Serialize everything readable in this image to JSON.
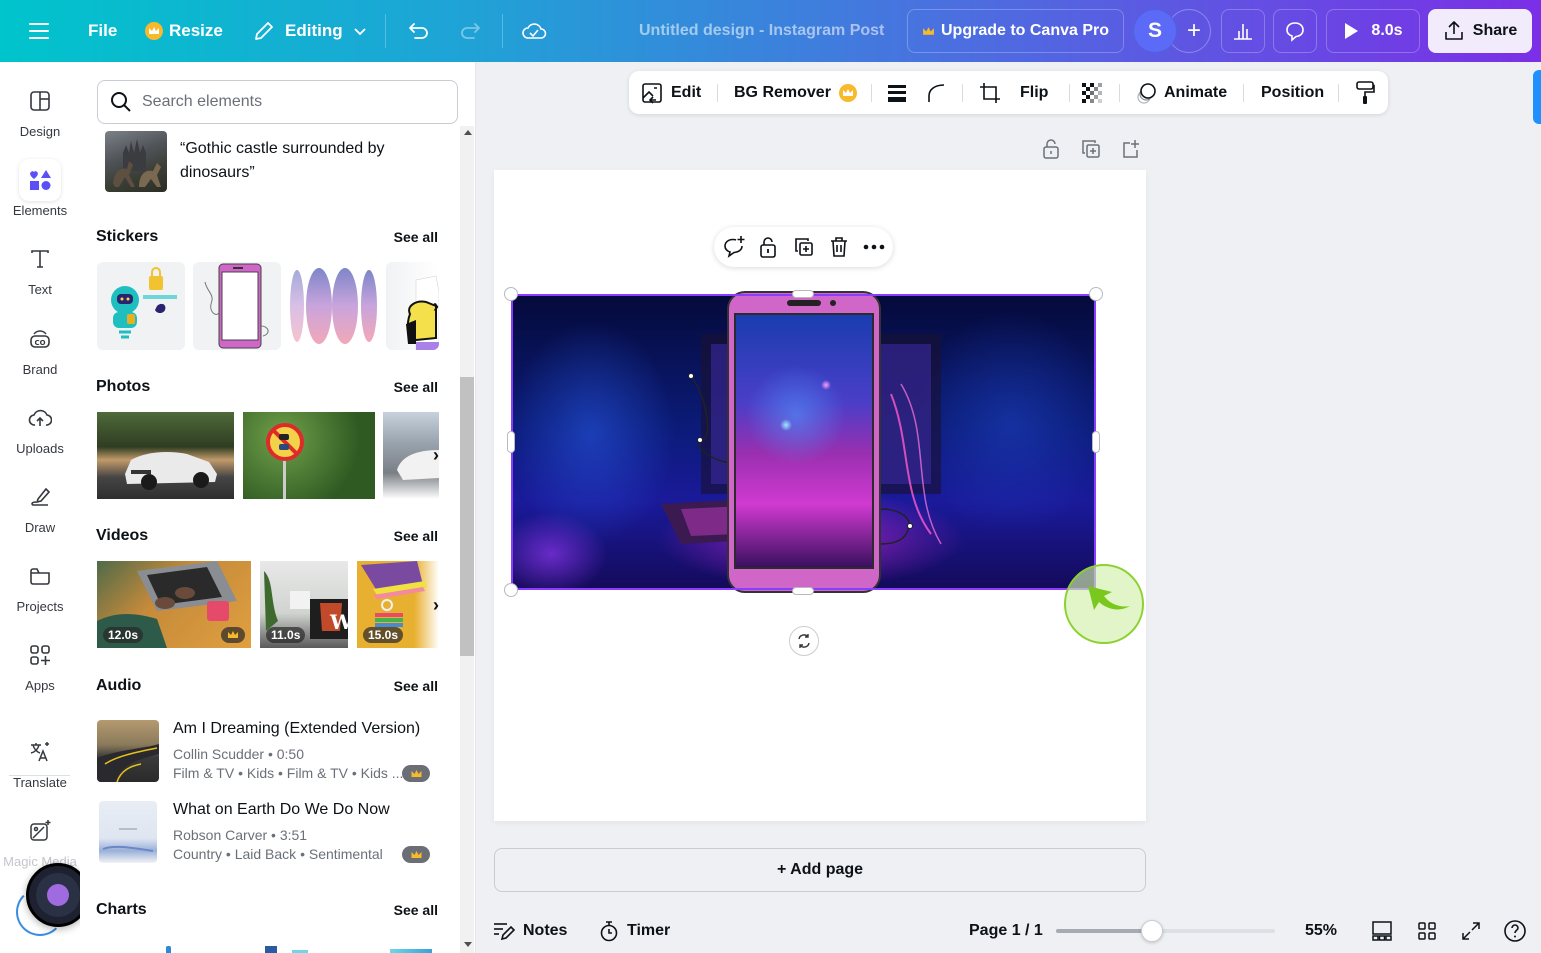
{
  "topbar": {
    "menu_icon": "hamburger-menu-icon",
    "file_label": "File",
    "resize_label": "Resize",
    "editing_label": "Editing",
    "design_title": "Untitled design - Instagram Post",
    "upgrade_label": "Upgrade to Canva Pro",
    "avatar_initial": "S",
    "add_collaborator": "+",
    "play_duration": "8.0s",
    "share_label": "Share"
  },
  "rail": {
    "items": [
      {
        "label": "Design",
        "icon": "design-layout-icon"
      },
      {
        "label": "Elements",
        "icon": "elements-shapes-icon",
        "active": true
      },
      {
        "label": "Text",
        "icon": "text-icon"
      },
      {
        "label": "Brand",
        "icon": "brand-icon"
      },
      {
        "label": "Uploads",
        "icon": "upload-cloud-icon"
      },
      {
        "label": "Draw",
        "icon": "draw-pen-icon"
      },
      {
        "label": "Projects",
        "icon": "folder-icon"
      },
      {
        "label": "Apps",
        "icon": "apps-grid-icon"
      },
      {
        "label": "Translate",
        "icon": "translate-icon"
      },
      {
        "label": "Magic Media",
        "icon": "magic-media-icon"
      }
    ]
  },
  "panel": {
    "search_placeholder": "Search elements",
    "ai_prompt": "“Gothic castle surrounded by dinosaurs”",
    "sections": {
      "stickers": {
        "title": "Stickers",
        "see_all": "See all"
      },
      "photos": {
        "title": "Photos",
        "see_all": "See all"
      },
      "videos": {
        "title": "Videos",
        "see_all": "See all",
        "items": [
          {
            "duration": "12.0s",
            "premium": true
          },
          {
            "duration": "11.0s",
            "premium": false
          },
          {
            "duration": "15.0s",
            "premium": false
          }
        ]
      },
      "audio": {
        "title": "Audio",
        "see_all": "See all",
        "items": [
          {
            "title": "Am I Dreaming (Extended Version)",
            "artist_duration": "Collin Scudder • 0:50",
            "tags": "Film & TV • Kids • Film & TV • Kids ...",
            "premium": true
          },
          {
            "title": "What on Earth Do We Do Now",
            "artist_duration": "Robson Carver • 3:51",
            "tags": "Country • Laid Back • Sentimental",
            "premium": true
          }
        ]
      },
      "charts": {
        "title": "Charts",
        "see_all": "See all"
      }
    }
  },
  "context_toolbar": {
    "edit": "Edit",
    "bg_remover": "BG Remover",
    "flip": "Flip",
    "animate": "Animate",
    "position": "Position"
  },
  "canvas": {
    "add_page": "+ Add page"
  },
  "bottombar": {
    "notes": "Notes",
    "timer": "Timer",
    "page_indicator": "Page 1 / 1",
    "zoom_percent": "55%",
    "zoom_slider_fraction": 0.44
  },
  "colors": {
    "accent": "#8b3dff",
    "crown": "#f8b92a",
    "avatar": "#5b6bf7"
  }
}
